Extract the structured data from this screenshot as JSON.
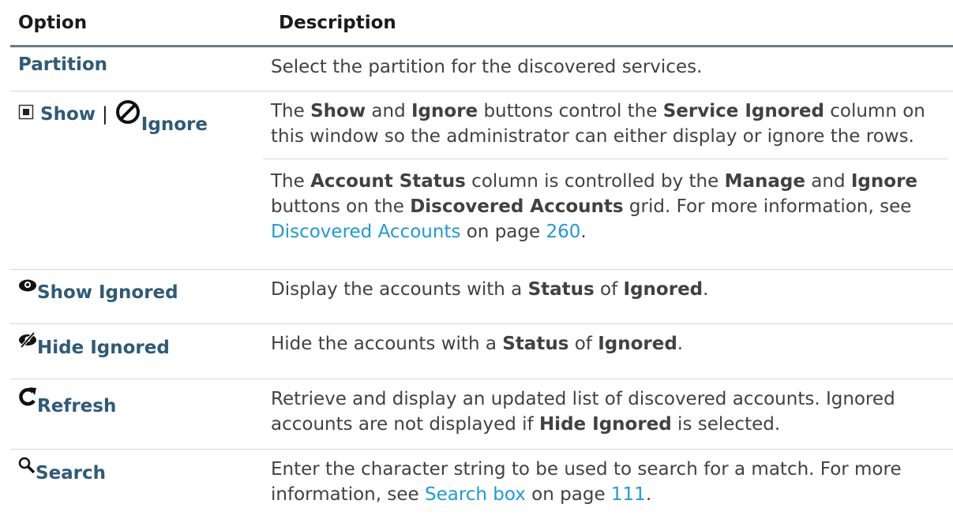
{
  "header": {
    "option": "Option",
    "description": "Description"
  },
  "rows": [
    {
      "option": "Partition",
      "desc": "Select the partition for the discovered services."
    },
    {
      "option_show": "Show",
      "option_sep": "|",
      "option_ignore": "Ignore",
      "icon_a": "square-icon",
      "icon_b": "ban-icon",
      "p1": {
        "t1": "The ",
        "b1": "Show",
        "t2": " and ",
        "b2": "Ignore",
        "t3": " buttons control the ",
        "b3": "Service Ignored",
        "t4": " column on this window so the administrator can either display or ignore the rows."
      },
      "p2": {
        "t1": "The ",
        "b1": "Account Status",
        "t2": " column is controlled by the ",
        "b2": "Manage",
        "t3": " and ",
        "b3": "Ignore",
        "t4": " buttons on the ",
        "b4": "Discovered Accounts",
        "t5": " grid. For more information, see ",
        "link1": "Discovered Accounts",
        "t6": " on page ",
        "link2": "260",
        "t7": "."
      }
    },
    {
      "icon": "eye-icon",
      "option": "Show Ignored",
      "t1": "Display the accounts with a ",
      "b1": "Status",
      "t2": " of ",
      "b2": "Ignored",
      "t3": "."
    },
    {
      "icon": "eye-slash-icon",
      "option": "Hide Ignored",
      "t1": "Hide the accounts with a ",
      "b1": "Status",
      "t2": " of ",
      "b2": "Ignored",
      "t3": "."
    },
    {
      "icon": "refresh-icon",
      "option": "Refresh",
      "t1": "Retrieve and display an updated list of discovered accounts. Ignored accounts are not displayed if ",
      "b1": "Hide Ignored",
      "t2": " is selected."
    },
    {
      "icon": "search-icon",
      "option": "Search",
      "t1": "Enter the character string to be used to search for a match. For more information, see ",
      "link1": "Search box",
      "t2": " on page ",
      "link2": "111",
      "t3": "."
    }
  ]
}
